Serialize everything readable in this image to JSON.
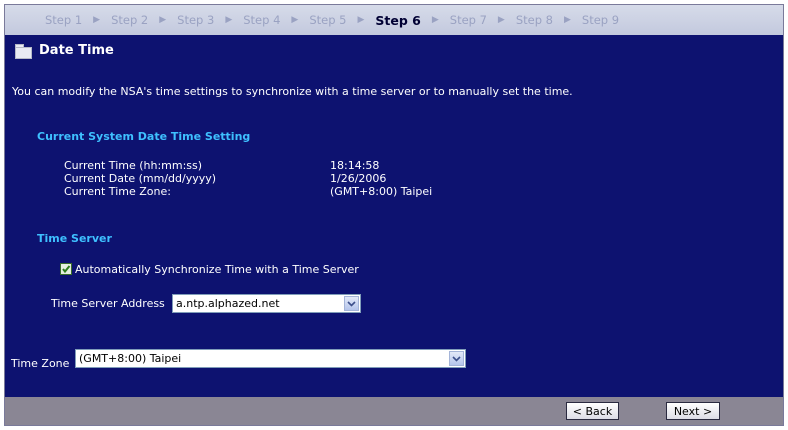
{
  "steps": [
    "Step 1",
    "Step 2",
    "Step 3",
    "Step 4",
    "Step 5",
    "Step 6",
    "Step 7",
    "Step 8",
    "Step 9"
  ],
  "active_step": "Step 6",
  "page_title": "Date Time",
  "description": "You can modify the NSA's time settings to synchronize with a time server or to manually set the time.",
  "current_section": {
    "heading": "Current System Date Time Setting",
    "time_label": "Current Time (hh:mm:ss)",
    "time_value": "18:14:58",
    "date_label": "Current Date (mm/dd/yyyy)",
    "date_value": "1/26/2006",
    "zone_label": "Current Time Zone:",
    "zone_value": "(GMT+8:00) Taipei"
  },
  "time_server": {
    "heading": "Time Server",
    "auto_sync_label": "Automatically Synchronize Time with a Time Server",
    "auto_sync_checked": true,
    "address_label": "Time Server Address",
    "address_value": "a.ntp.alphazed.net"
  },
  "time_zone": {
    "label": "Time Zone",
    "value": "(GMT+8:00) Taipei"
  },
  "buttons": {
    "back": "< Back",
    "next": "Next >"
  },
  "colors": {
    "background": "#0d1270",
    "section_heading": "#3ec0ff",
    "footer": "#8a8694"
  }
}
